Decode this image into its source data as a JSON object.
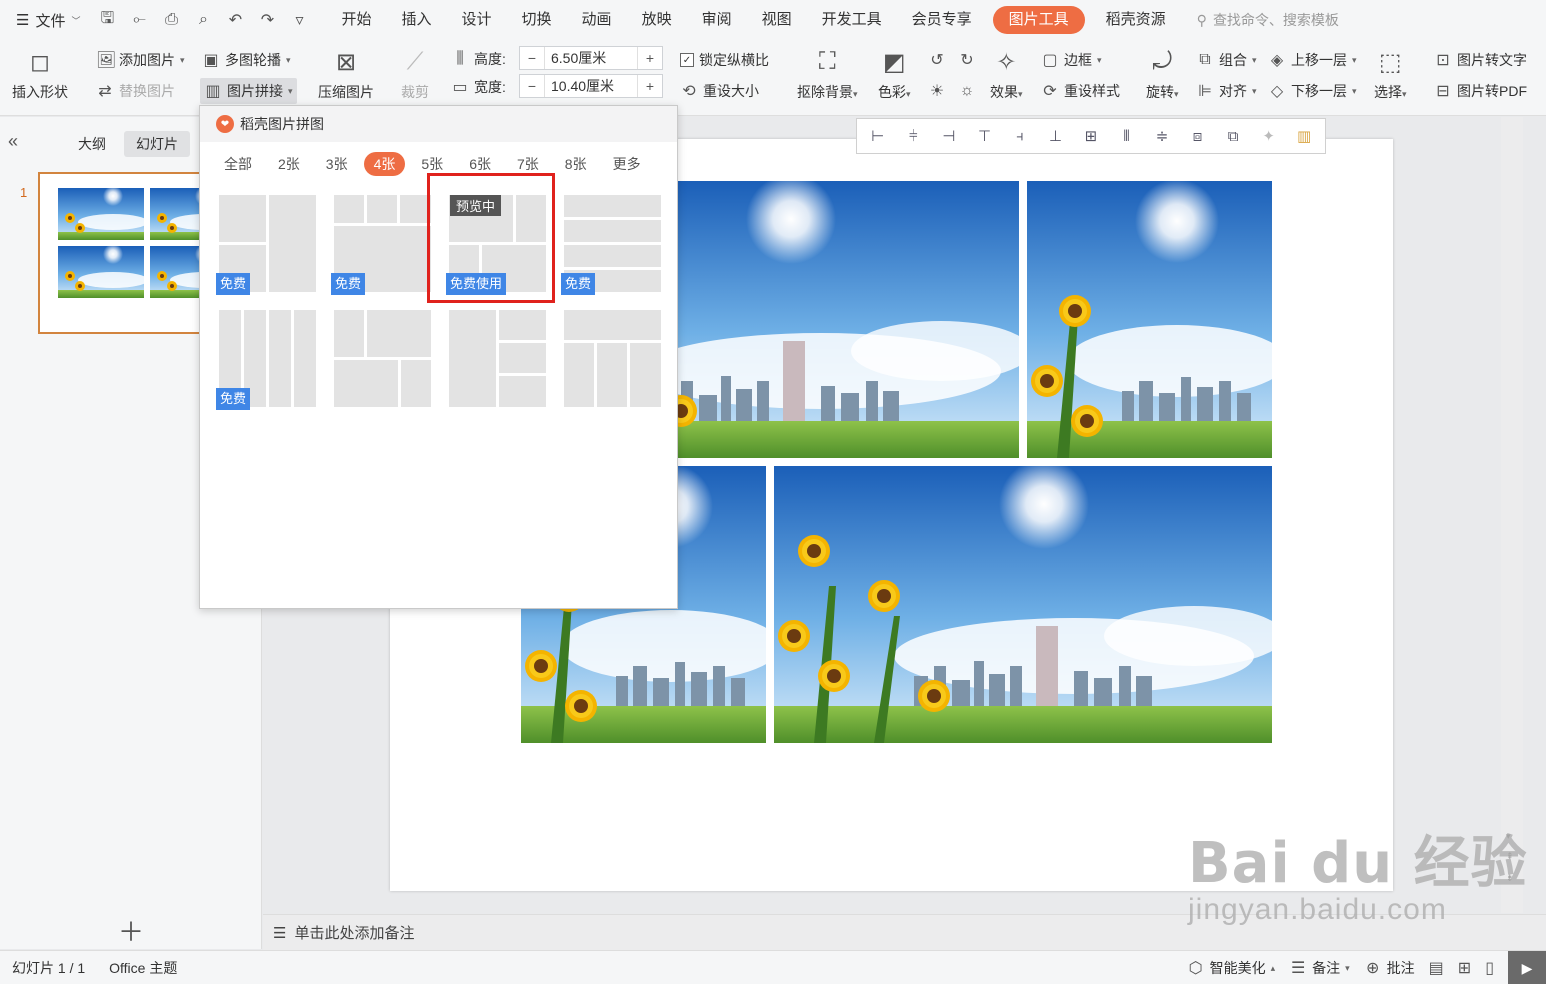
{
  "menubar": {
    "file_label": "文件",
    "tabs": [
      "开始",
      "插入",
      "设计",
      "切换",
      "动画",
      "放映",
      "审阅",
      "视图",
      "开发工具",
      "会员专享"
    ],
    "active_tab": "图片工具",
    "extra_tab": "稻壳资源",
    "search_placeholder": "查找命令、搜索模板"
  },
  "ribbon": {
    "insert_shape": "插入形状",
    "add_picture": "添加图片",
    "replace_picture": "替换图片",
    "multi_carousel": "多图轮播",
    "picture_collage": "图片拼接",
    "compress_picture": "压缩图片",
    "crop": "裁剪",
    "height_label": "高度:",
    "height_value": "6.50厘米",
    "width_label": "宽度:",
    "width_value": "10.40厘米",
    "lock_ratio": "锁定纵横比",
    "reset_size": "重设大小",
    "remove_bg": "抠除背景",
    "color": "色彩",
    "effect": "效果",
    "border": "边框",
    "reset_style": "重设样式",
    "rotate": "旋转",
    "group": "组合",
    "align": "对齐",
    "bring_forward": "上移一层",
    "send_backward": "下移一层",
    "select": "选择",
    "pic_to_text": "图片转文字",
    "pic_to_pdf": "图片转PDF"
  },
  "left_panel": {
    "tab_outline": "大纲",
    "tab_slides": "幻灯片",
    "slide_number": "1"
  },
  "popup": {
    "title": "稻壳图片拼图",
    "tabs": [
      "全部",
      "2张",
      "3张",
      "4张",
      "5张",
      "6张",
      "7张",
      "8张",
      "更多"
    ],
    "active_tab_index": 3,
    "free_badge": "免费",
    "free_use_badge": "免费使用",
    "preview_tag": "预览中"
  },
  "notes": {
    "placeholder": "单击此处添加备注"
  },
  "statusbar": {
    "slide_count": "幻灯片 1 / 1",
    "theme": "Office 主题",
    "smart_beautify": "智能美化",
    "notes": "备注",
    "comments": "批注"
  },
  "watermark": {
    "logo": "Bai du 经验",
    "url": "jingyan.baidu.com"
  },
  "colors": {
    "accent": "#ee6d43",
    "badge": "#3f86e6",
    "highlight": "#e0221d"
  }
}
